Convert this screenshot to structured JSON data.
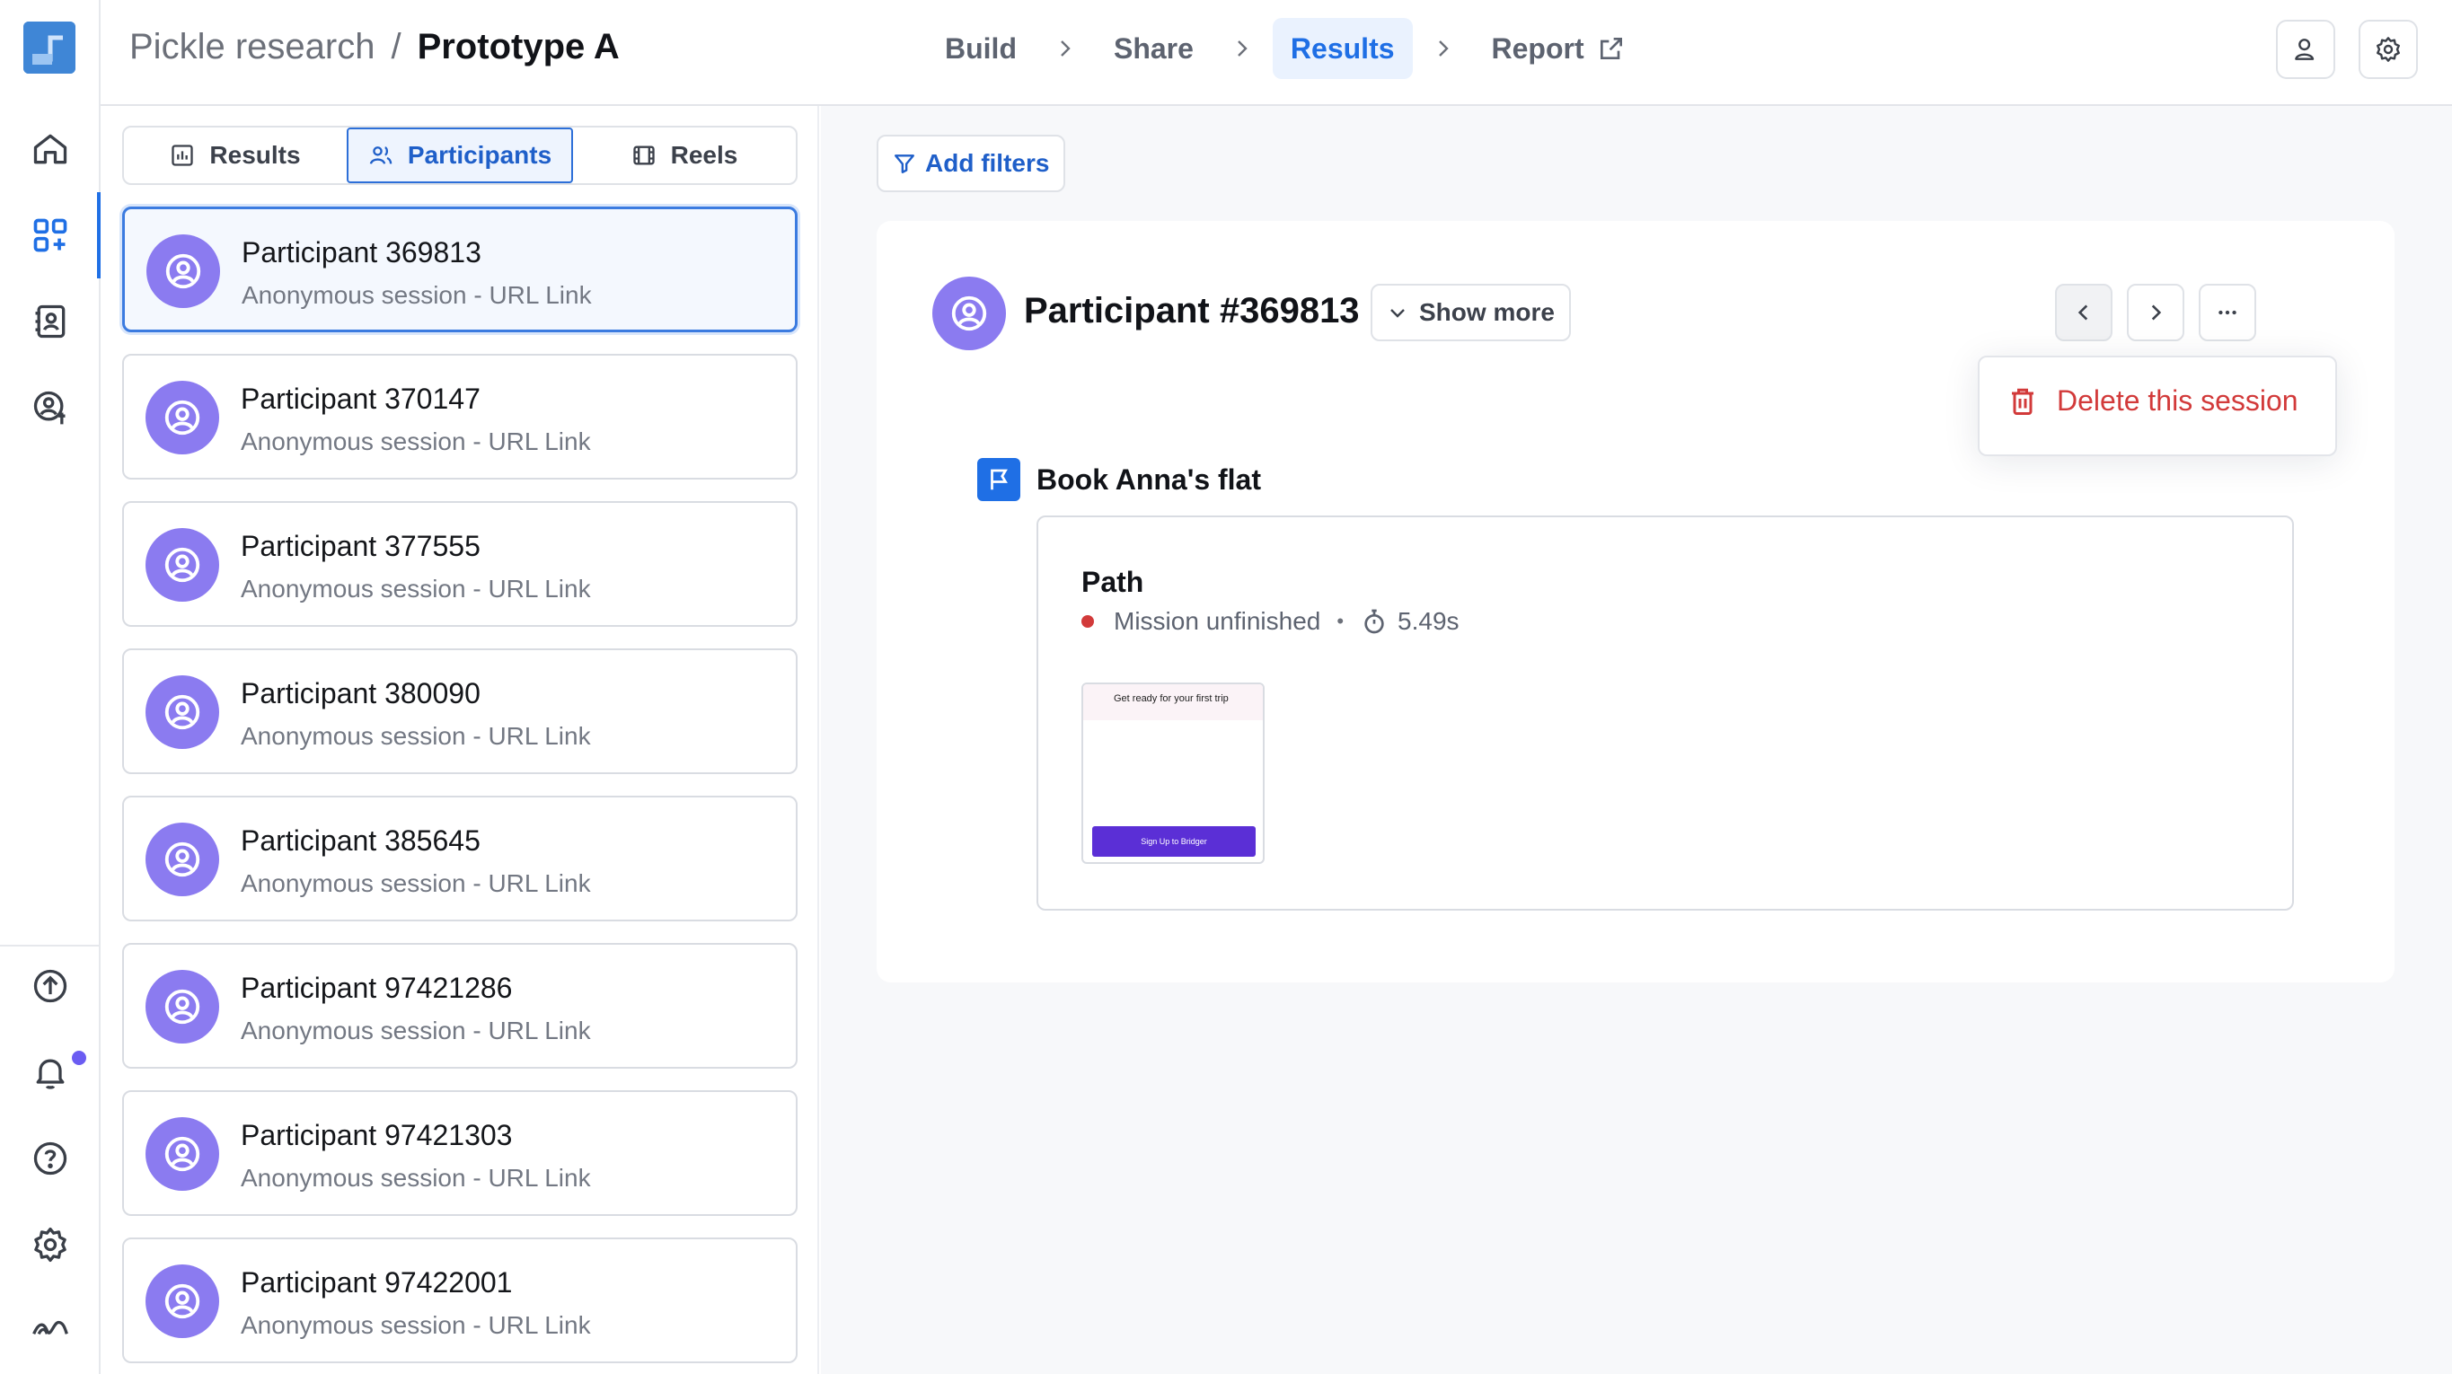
{
  "sidebar": {
    "logo": "app-logo",
    "items": [
      {
        "name": "home-icon"
      },
      {
        "name": "dashboard-icon"
      },
      {
        "name": "contacts-book-icon"
      },
      {
        "name": "participant-credit-icon"
      }
    ],
    "bottom_items": [
      {
        "name": "upgrade-icon"
      },
      {
        "name": "bell-icon"
      },
      {
        "name": "help-icon"
      },
      {
        "name": "gear-icon"
      },
      {
        "name": "maze-logo-icon"
      }
    ]
  },
  "header": {
    "project": "Pickle research",
    "separator": "/",
    "current": "Prototype A",
    "steps": [
      {
        "label": "Build"
      },
      {
        "label": "Share"
      },
      {
        "label": "Results",
        "active": true
      },
      {
        "label": "Report"
      }
    ]
  },
  "tabs": [
    {
      "label": "Results",
      "icon": "bar-chart-icon"
    },
    {
      "label": "Participants",
      "icon": "users-icon",
      "active": true
    },
    {
      "label": "Reels",
      "icon": "film-icon"
    }
  ],
  "participants": [
    {
      "name": "Participant 369813",
      "sub": "Anonymous session - URL Link",
      "selected": true
    },
    {
      "name": "Participant 370147",
      "sub": "Anonymous session - URL Link"
    },
    {
      "name": "Participant 377555",
      "sub": "Anonymous session - URL Link"
    },
    {
      "name": "Participant 380090",
      "sub": "Anonymous session - URL Link"
    },
    {
      "name": "Participant 385645",
      "sub": "Anonymous session - URL Link"
    },
    {
      "name": "Participant 97421286",
      "sub": "Anonymous session - URL Link"
    },
    {
      "name": "Participant 97421303",
      "sub": "Anonymous session - URL Link"
    },
    {
      "name": "Participant 97422001",
      "sub": "Anonymous session - URL Link"
    }
  ],
  "detail": {
    "filters_label": "Add filters",
    "title": "Participant #369813",
    "show_more": "Show more",
    "menu": {
      "delete_label": "Delete this session"
    },
    "task": {
      "name": "Book Anna's flat"
    },
    "path": {
      "title": "Path",
      "status": "Mission unfinished",
      "bullet": "•",
      "duration": "5.49s",
      "thumb_title": "Get ready for your first trip",
      "thumb_cta": "Sign Up to Bridger"
    }
  },
  "colors": {
    "accent": "#1f6fe5",
    "avatar": "#8b7bf0",
    "danger": "#d23a3a",
    "cta": "#5b2fd6"
  }
}
